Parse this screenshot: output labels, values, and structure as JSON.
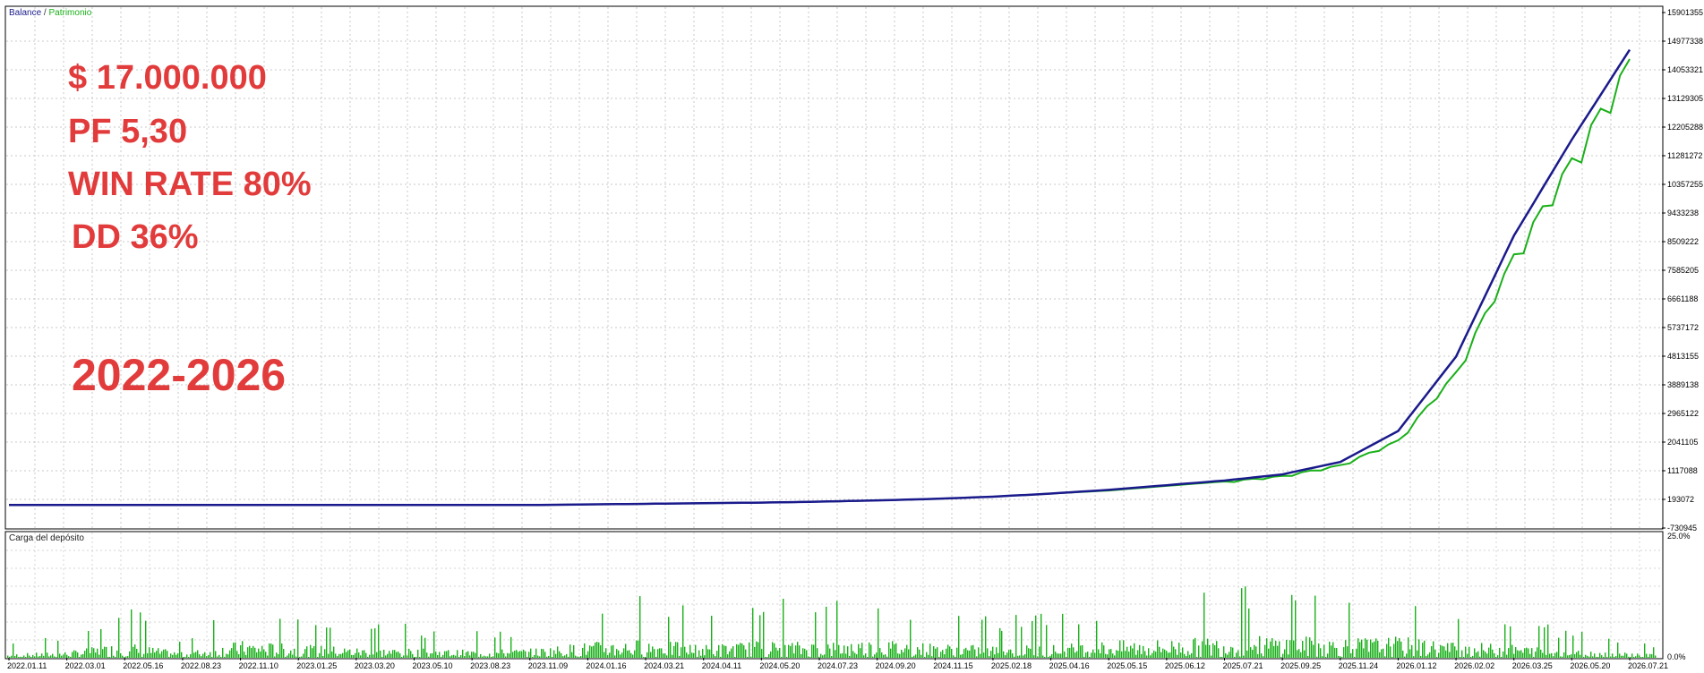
{
  "legend": {
    "balance": "Balance",
    "separator": " / ",
    "equity": "Patrimonio",
    "balance_color": "#1a1a8c",
    "equity_color": "#19b019"
  },
  "annotations": {
    "profit": "$ 17.000.000",
    "pf": "PF 5,30",
    "win_rate": "WIN RATE 80%",
    "dd": "DD 36%",
    "years": "2022-2026",
    "color": "#e23b3b"
  },
  "chart_data": [
    {
      "type": "line",
      "x": [
        "2022.01.11",
        "2022.03.01",
        "2022.05.16",
        "2022.08.23",
        "2022.11.10",
        "2023.01.25",
        "2023.03.20",
        "2023.05.10",
        "2023.08.23",
        "2023.11.09",
        "2024.01.16",
        "2024.03.21",
        "2024.04.11",
        "2024.05.20",
        "2024.07.23",
        "2024.09.20",
        "2024.11.15",
        "2025.02.18",
        "2025.04.16",
        "2025.05.15",
        "2025.06.12",
        "2025.07.21",
        "2025.09.25",
        "2025.11.24",
        "2026.01.12",
        "2026.02.02",
        "2026.03.25",
        "2026.05.20",
        "2026.07.21"
      ],
      "series": [
        {
          "name": "Balance",
          "color": "#1a1a8c",
          "values": [
            10000,
            10000,
            10000,
            10000,
            10000,
            10000,
            10000,
            10000,
            10000,
            12000,
            30000,
            50000,
            70000,
            90000,
            120000,
            160000,
            210000,
            280000,
            380000,
            500000,
            650000,
            800000,
            1000000,
            1400000,
            2400000,
            4800000,
            8700000,
            11800000,
            14700000
          ]
        },
        {
          "name": "Patrimonio",
          "color": "#19b019",
          "values": [
            10000,
            10000,
            10000,
            10000,
            10000,
            10000,
            10000,
            10000,
            10000,
            12000,
            30000,
            50000,
            70000,
            90000,
            120000,
            160000,
            210000,
            280000,
            380000,
            480000,
            630000,
            770000,
            950000,
            1300000,
            2100000,
            4300000,
            8100000,
            11200000,
            14400000
          ]
        }
      ],
      "yticks": [
        "15901355",
        "14977338",
        "14053321",
        "13129305",
        "12205288",
        "11281272",
        "10357255",
        "9433238",
        "8509222",
        "7585205",
        "6661188",
        "5737172",
        "4813155",
        "3889138",
        "2965122",
        "2041105",
        "1117088",
        "193072",
        "-730945"
      ],
      "ylim": [
        -730945,
        15901355
      ],
      "grid": true,
      "legend": "top-left"
    },
    {
      "type": "bar",
      "title": "Carga del depósito",
      "color": "#19b019",
      "yticks": [
        "25.0%",
        "0.0%"
      ],
      "ylim": [
        0,
        25
      ],
      "x_categories": [
        "2022.01.11",
        "2022.03.01",
        "2022.05.16",
        "2022.08.23",
        "2022.11.10",
        "2023.01.25",
        "2023.03.20",
        "2023.05.10",
        "2023.08.23",
        "2023.11.09",
        "2024.01.16",
        "2024.03.21",
        "2024.04.11",
        "2024.05.20",
        "2024.07.23",
        "2024.09.20",
        "2024.11.15",
        "2025.02.18",
        "2025.04.16",
        "2025.05.15",
        "2025.06.12",
        "2025.07.21",
        "2025.09.25",
        "2025.11.24",
        "2026.01.12",
        "2026.02.02",
        "2026.03.25",
        "2026.05.20",
        "2026.07.21"
      ],
      "values": [
        3,
        5,
        12,
        4,
        13,
        10,
        8,
        7,
        6,
        7,
        12,
        14,
        10,
        13,
        12,
        14,
        11,
        9,
        10,
        13,
        14,
        16,
        17,
        15,
        16,
        12,
        10,
        6,
        4
      ],
      "grid": true
    }
  ]
}
